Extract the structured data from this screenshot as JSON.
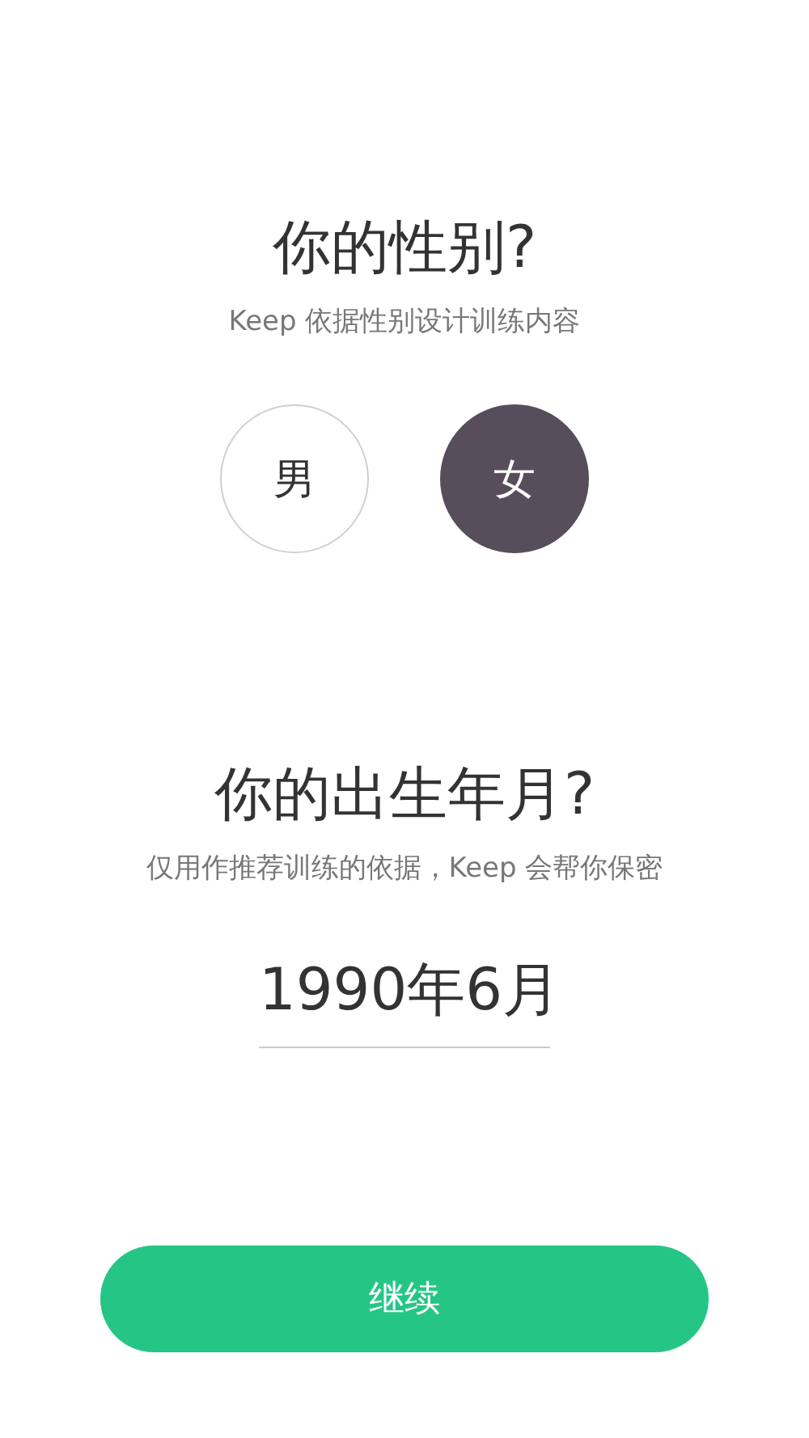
{
  "gender_section": {
    "title": "你的性别?",
    "subtitle": "Keep 依据性别设计训练内容",
    "options": [
      {
        "label": "男",
        "selected": false
      },
      {
        "label": "女",
        "selected": true
      }
    ]
  },
  "birth_section": {
    "title": "你的出生年月?",
    "subtitle": "仅用作推荐训练的依据，Keep 会帮你保密",
    "value": "1990年6月"
  },
  "continue_button": "继续"
}
